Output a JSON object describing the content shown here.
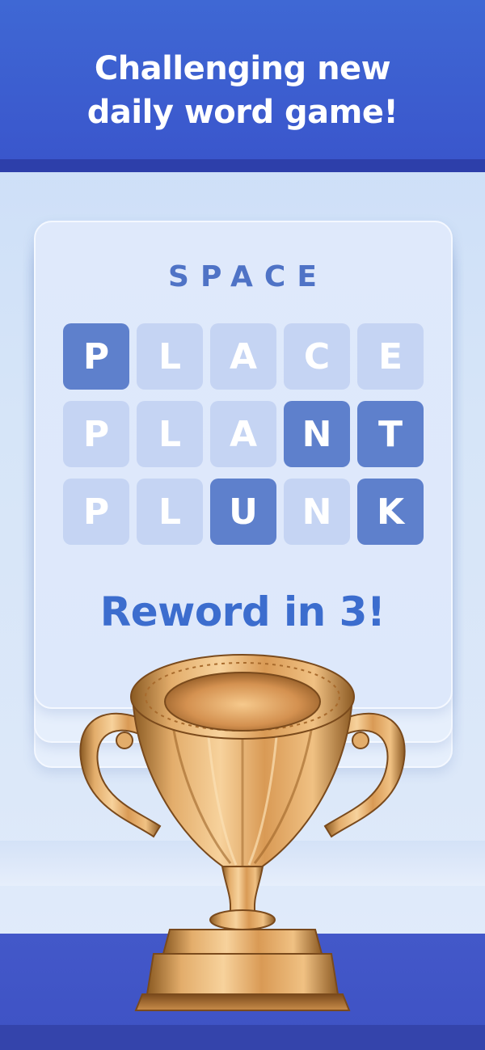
{
  "header": {
    "headline_line1": "Challenging new",
    "headline_line2": "daily word game!"
  },
  "puzzle": {
    "target_word": "SPACE",
    "rows": [
      {
        "tiles": [
          {
            "letter": "P",
            "highlight": true
          },
          {
            "letter": "L",
            "highlight": false
          },
          {
            "letter": "A",
            "highlight": false
          },
          {
            "letter": "C",
            "highlight": false
          },
          {
            "letter": "E",
            "highlight": false
          }
        ]
      },
      {
        "tiles": [
          {
            "letter": "P",
            "highlight": false
          },
          {
            "letter": "L",
            "highlight": false
          },
          {
            "letter": "A",
            "highlight": false
          },
          {
            "letter": "N",
            "highlight": true
          },
          {
            "letter": "T",
            "highlight": true
          }
        ]
      },
      {
        "tiles": [
          {
            "letter": "P",
            "highlight": false
          },
          {
            "letter": "L",
            "highlight": false
          },
          {
            "letter": "U",
            "highlight": true
          },
          {
            "letter": "N",
            "highlight": false
          },
          {
            "letter": "K",
            "highlight": true
          }
        ]
      }
    ],
    "tagline": "Reword in 3!"
  },
  "colors": {
    "banner": "#3a56cc",
    "tile_highlight": "#5e80cc",
    "tile_plain": "#c5d4f3",
    "tagline": "#3c6dce",
    "trophy": "gold"
  },
  "icons": {
    "trophy": "trophy-icon"
  }
}
